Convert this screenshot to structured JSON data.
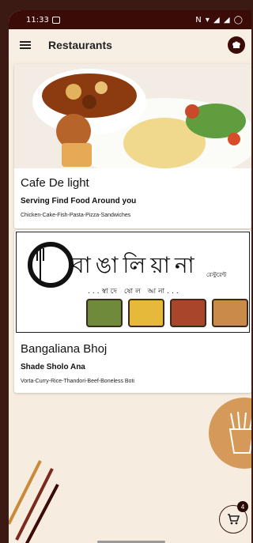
{
  "status": {
    "time": "11:33",
    "right": "N ▾ ◢ ◢ ◯"
  },
  "appbar": {
    "title": "Restaurants"
  },
  "restaurants": [
    {
      "name": "Cafe De light",
      "tagline": "Serving Find Food Around you",
      "categories": "Chicken-Cake-Fish-Pasta-Pizza-Sandwiches"
    },
    {
      "name": "Bangaliana Bhoj",
      "tagline": "Shade Sholo Ana",
      "categories": "Vorta-Curry-Rice-Thandori-Beef-Boneless Boti",
      "banner_title": "বাঙালিয়ানা",
      "banner_sub": "...স্বাদে ষোল আনা...",
      "banner_small": "রেস্টুরেন্ট"
    }
  ],
  "cart": {
    "count": "4"
  },
  "colors": {
    "brand_dark": "#3a0b07",
    "background": "#f6ece0",
    "accent": "#d59a5a"
  }
}
